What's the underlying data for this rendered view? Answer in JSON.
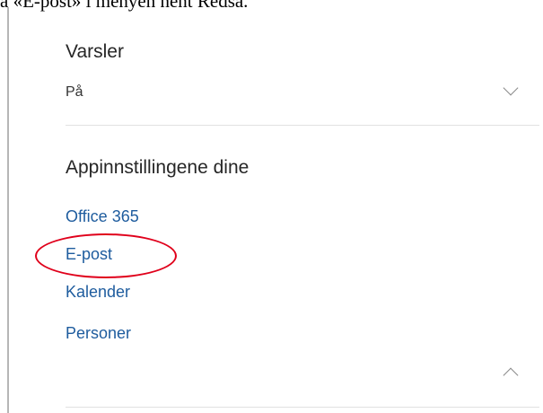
{
  "intro": {
    "text": "a «E-post» i menyen nent Redsa."
  },
  "notifications": {
    "title": "Varsler",
    "value": "På",
    "expand_icon": "chevron-down-icon"
  },
  "app_settings": {
    "title": "Appinnstillingene dine",
    "links": [
      {
        "label": "Office 365"
      },
      {
        "label": "E-post"
      },
      {
        "label": "Kalender"
      },
      {
        "label": "Personer"
      }
    ],
    "collapse_icon": "chevron-up-icon"
  },
  "annotation": {
    "highlight_color": "#e0001b",
    "highlighted_item": "E-post"
  },
  "colors": {
    "link": "#1e5c9e",
    "text": "#262626",
    "divider": "#e1e1e1"
  }
}
